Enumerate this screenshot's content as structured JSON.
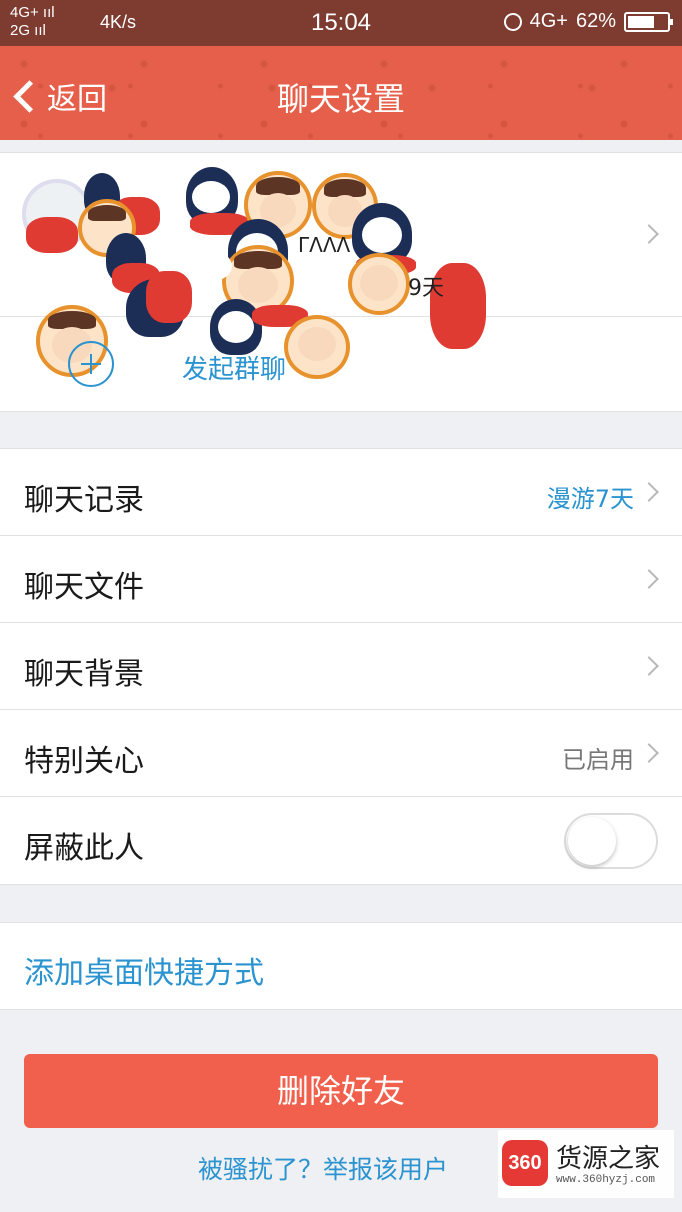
{
  "status_bar": {
    "network_top": "4G+ ııl",
    "network_bottom": "2G ııl",
    "speed": "4K/s",
    "time": "15:04",
    "network_right": "4G+",
    "battery": "62%"
  },
  "nav": {
    "back_label": "返回",
    "title": "聊天设置"
  },
  "profile": {
    "nickname_fragment": "ΓΛΛΛ",
    "age_fragment": "9天",
    "start_group_label": "发起群聊"
  },
  "settings": [
    {
      "label": "聊天记录",
      "value": "漫游7天"
    },
    {
      "label": "聊天文件",
      "value": ""
    },
    {
      "label": "聊天背景",
      "value": ""
    },
    {
      "label": "特别关心",
      "value": "已启用"
    },
    {
      "label": "屏蔽此人",
      "toggle_on": false
    }
  ],
  "shortcut_label": "添加桌面快捷方式",
  "delete_label": "删除好友",
  "report_label": "被骚扰了？举报该用户",
  "watermark": {
    "logo": "360",
    "name": "货源之家",
    "url": "www.360hyzj.com"
  },
  "colors": {
    "accent_blue": "#2a93d0",
    "nav_red": "#e65f4b",
    "delete_red": "#f0604c"
  }
}
